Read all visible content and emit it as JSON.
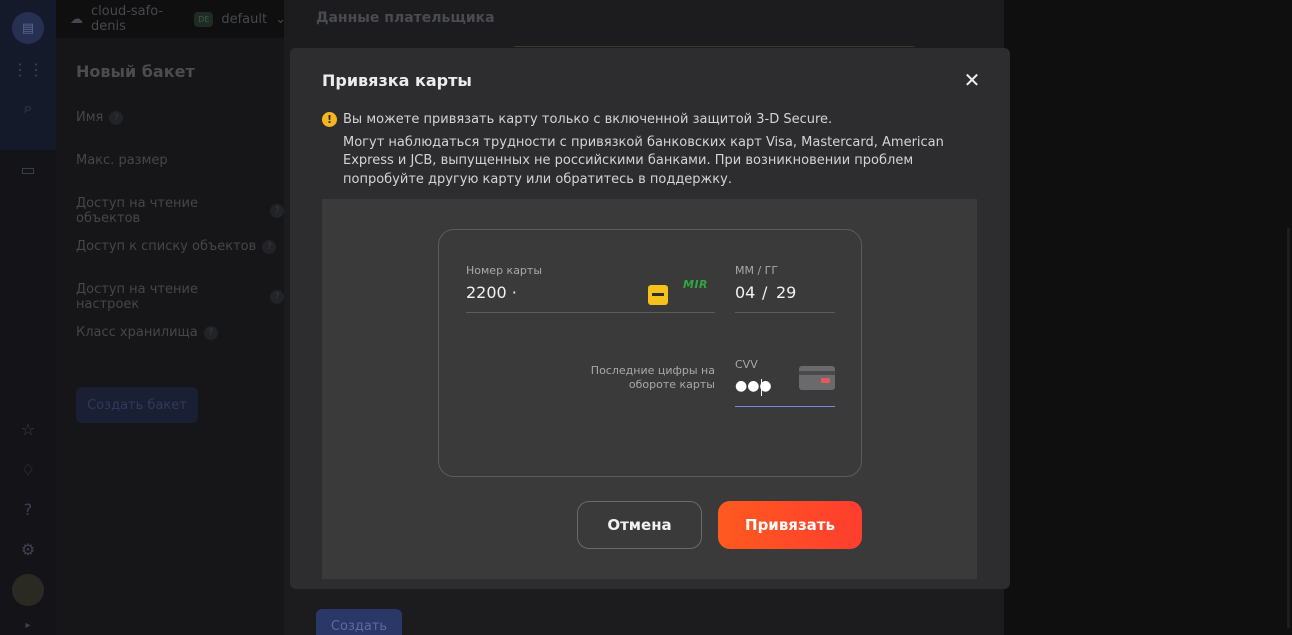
{
  "topbar": {
    "cloud": "cloud-safo-denis",
    "folder_badge": "DE",
    "folder": "default"
  },
  "left_form": {
    "title": "Новый бакет",
    "fields": [
      "Имя",
      "Макс. размер",
      "Доступ на чтение объектов",
      "Доступ к списку объектов",
      "Доступ на чтение настроек",
      "Класс хранилища"
    ],
    "create_bucket": "Создать бакет"
  },
  "sheet": {
    "title": "Данные плательщика",
    "create": "Создать"
  },
  "modal": {
    "title": "Привязка карты",
    "close": "✕",
    "notice_line1": "Вы можете привязать карту только с включенной защитой 3-D Secure.",
    "notice_line2": "Могут наблюдаться трудности с привязкой банковских карт Visa, Mastercard, American Express и JCB, выпущенных не российскими банками. При возникновении проблем попробуйте другую карту или обратитесь в поддержку.",
    "card_number_label": "Номер карты",
    "card_number_value": "2200 ·",
    "payment_system": "MIR",
    "expiry_label": "ММ  /  ГГ",
    "expiry_month": "04",
    "expiry_sep": "/",
    "expiry_year": "29",
    "cvv_hint": "Последние цифры на обороте карты",
    "cvv_label": "CVV",
    "cvv_value": "●●●",
    "cancel": "Отмена",
    "bind": "Привязать"
  },
  "colors": {
    "accent": "#ff4a26",
    "warning": "#f5b621",
    "mir_green": "#2fa83f",
    "chip": "#f5c21a"
  }
}
